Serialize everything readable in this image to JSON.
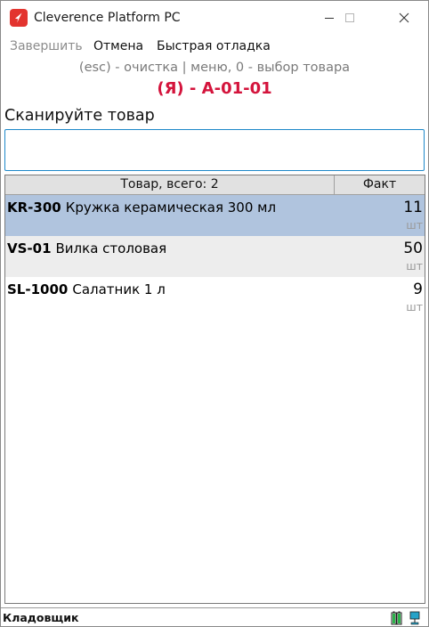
{
  "window": {
    "title": "Cleverence Platform PC",
    "accent": "#e3342f"
  },
  "menu": {
    "items": [
      {
        "label": "Завершить",
        "enabled": false
      },
      {
        "label": "Отмена",
        "enabled": true
      },
      {
        "label": "Быстрая отладка",
        "enabled": true
      }
    ]
  },
  "screen": {
    "hint": "(esc) - очистка | меню, 0 - выбор товара",
    "location": "(Я) - А-01-01",
    "location_color": "#d4143c",
    "prompt": "Сканируйте товар",
    "input_value": "",
    "input_border_color": "#1e88c9"
  },
  "grid": {
    "header_goods": "Товар, всего: 2",
    "header_fact": "Факт",
    "rows": [
      {
        "code": "KR-300",
        "name": "Кружка  керамическая 300 мл",
        "qty": "11",
        "unit": "шт",
        "selected": true
      },
      {
        "code": "VS-01",
        "name": "Вилка столовая",
        "qty": "50",
        "unit": "шт",
        "selected": false
      },
      {
        "code": "SL-1000",
        "name": "Салатник  1 л",
        "qty": "9",
        "unit": "шт",
        "selected": false
      }
    ],
    "selected_color": "#b0c4de",
    "alt_color": "#ededed"
  },
  "status": {
    "user_role": "Кладовщик",
    "battery_icon": "battery-icon",
    "network_icon": "network-icon"
  }
}
